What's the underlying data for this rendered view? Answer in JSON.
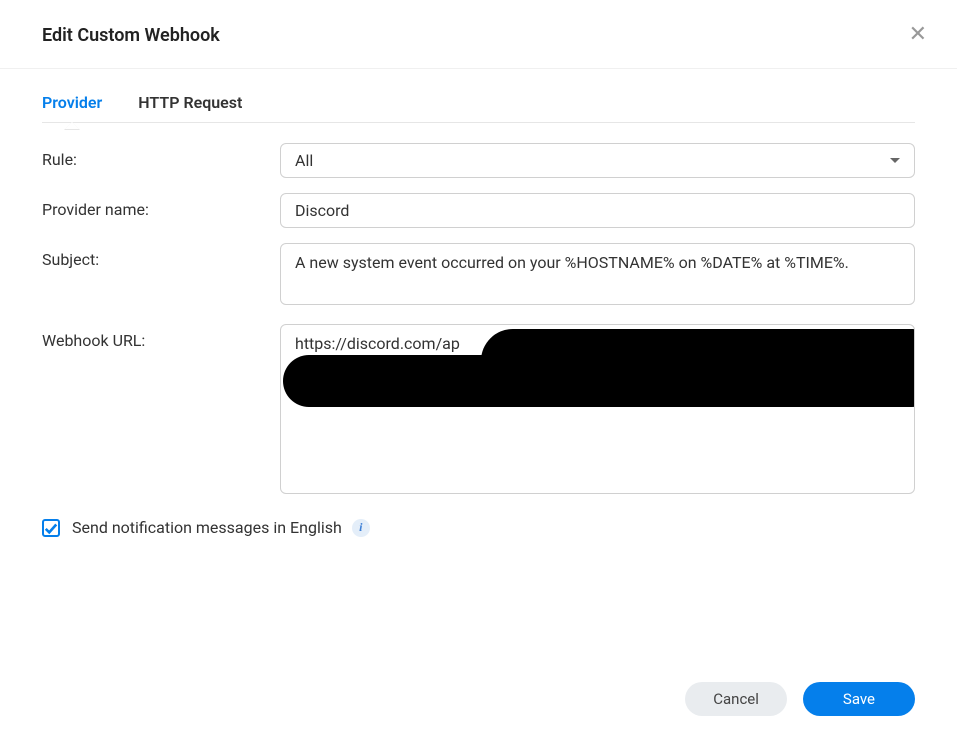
{
  "dialog": {
    "title": "Edit Custom Webhook"
  },
  "tabs": {
    "provider": "Provider",
    "http_request": "HTTP Request"
  },
  "form": {
    "rule_label": "Rule:",
    "rule_value": "All",
    "provider_name_label": "Provider name:",
    "provider_name_value": "Discord",
    "subject_label": "Subject:",
    "subject_value": "A new system event occurred on your %HOSTNAME% on %DATE% at %TIME%.",
    "webhook_url_label": "Webhook URL:",
    "webhook_url_value": "https://discord.com/ap",
    "english_notifications_label": "Send notification messages in English",
    "english_notifications_checked": true
  },
  "footer": {
    "cancel": "Cancel",
    "save": "Save"
  }
}
